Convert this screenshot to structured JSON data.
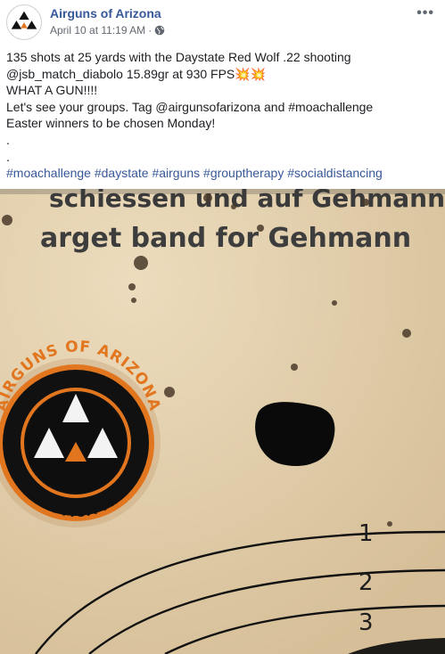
{
  "post": {
    "page_name": "Airguns of Arizona",
    "timestamp": "April 10 at 11:19 AM",
    "separator": "·",
    "more_icon": "more-horizontal-icon",
    "privacy_icon": "globe-icon",
    "lines": [
      "135 shots at 25 yards with the Daystate Red Wolf .22 shooting",
      "@jsb_match_diabolo 15.89gr at 930 FPS💥💥",
      "WHAT A GUN!!!!",
      "Let's see your groups. Tag @airgunsofarizona and #moachallenge",
      "Easter winners to be chosen Monday!",
      ".",
      "."
    ],
    "hashtags": "#moachallenge #daystate #airguns #grouptherapy #socialdistancing"
  },
  "photo": {
    "target_text_top": "schiessen und auf Gehmann",
    "target_text": "arget band for Gehmann",
    "ring_numbers": [
      "1",
      "2",
      "3"
    ],
    "coin_top_text": "AIRGUNS OF ARIZONA",
    "coin_bottom_text": "OFFICIAL MOA MARKER",
    "colors": {
      "accent_orange": "#e2761f",
      "coin_black": "#0e0e0e",
      "paper": "#e6d0ad"
    }
  }
}
